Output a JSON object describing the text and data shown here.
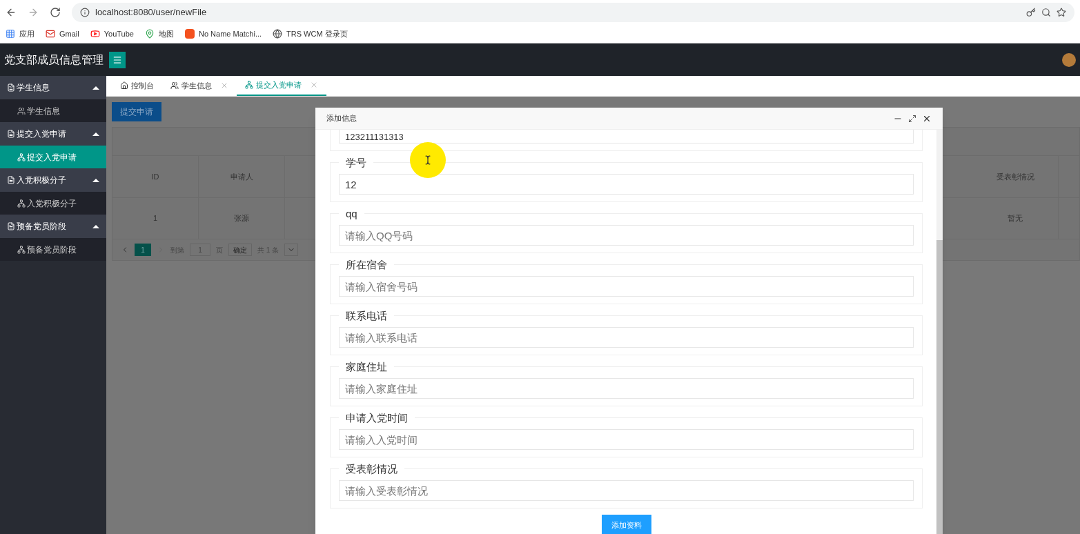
{
  "browser": {
    "url": "localhost:8080/user/newFile",
    "bookmarks": [
      {
        "label": "应用",
        "kind": "apps"
      },
      {
        "label": "Gmail",
        "kind": "mail"
      },
      {
        "label": "YouTube",
        "kind": "video"
      },
      {
        "label": "地图",
        "kind": "map"
      },
      {
        "label": "No Name Matchi...",
        "kind": "c"
      },
      {
        "label": "TRS WCM 登录页",
        "kind": "globe"
      }
    ]
  },
  "app": {
    "title": "党支部成员信息管理"
  },
  "sidebar": {
    "groups": [
      {
        "label": "学生信息",
        "expanded": true,
        "children": [
          {
            "label": "学生信息",
            "kind": "users",
            "selected": false
          }
        ]
      },
      {
        "label": "提交入党申请",
        "expanded": true,
        "children": [
          {
            "label": "提交入党申请",
            "kind": "sitemap",
            "selected": true
          }
        ]
      },
      {
        "label": "入党积极分子",
        "expanded": true,
        "children": [
          {
            "label": "入党积极分子",
            "kind": "sitemap",
            "selected": false
          }
        ]
      },
      {
        "label": "预备党员阶段",
        "expanded": true,
        "children": [
          {
            "label": "预备党员阶段",
            "kind": "sitemap",
            "selected": false
          }
        ]
      }
    ]
  },
  "tabs": [
    {
      "label": "控制台",
      "kind": "home",
      "closable": false,
      "selected": false
    },
    {
      "label": "学生信息",
      "kind": "users",
      "closable": true,
      "selected": false
    },
    {
      "label": "提交入党申请",
      "kind": "sitemap",
      "closable": true,
      "selected": true
    }
  ],
  "page": {
    "button": "提交申请",
    "table": {
      "columns": [
        "ID",
        "申请人",
        "受表彰情况"
      ],
      "rows": [
        [
          "1",
          "张源",
          "暂无"
        ]
      ]
    },
    "pagination": {
      "current": "1",
      "goto_label": "到第",
      "goto_value": "1",
      "page_label": "页",
      "confirm": "确定",
      "total": "共 1 条"
    }
  },
  "modal": {
    "title": "添加信息",
    "partial_value": "123211131313",
    "fields": [
      {
        "label": "学号",
        "value": "12"
      },
      {
        "label": "qq",
        "placeholder": "请输入QQ号码"
      },
      {
        "label": "所在宿舍",
        "placeholder": "请输入宿舍号码"
      },
      {
        "label": "联系电话",
        "placeholder": "请输入联系电话"
      },
      {
        "label": "家庭住址",
        "placeholder": "请输入家庭住址"
      },
      {
        "label": "申请入党时间",
        "placeholder": "请输入入党时间"
      },
      {
        "label": "受表彰情况",
        "placeholder": "请输入受表彰情况"
      }
    ],
    "submit": "添加资料"
  }
}
